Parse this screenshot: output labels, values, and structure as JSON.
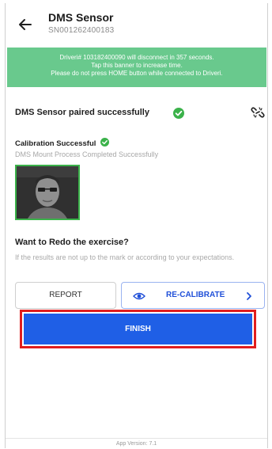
{
  "header": {
    "title": "DMS Sensor",
    "serial": "SN001262400183"
  },
  "banner": {
    "line1": "Driveri# 103182400090 will disconnect in 357 seconds.",
    "line2": "Tap this banner to increase time.",
    "line3": "Please do not press HOME button while connected to Driveri."
  },
  "status": {
    "paired_text": "DMS Sensor paired successfully",
    "calibration_title": "Calibration Successful",
    "calibration_subtitle": "DMS Mount Process Completed Successfully"
  },
  "redo": {
    "title": "Want to Redo the exercise?",
    "description": "If the results are not up to the mark or according to your expectations."
  },
  "buttons": {
    "report": "REPORT",
    "recalibrate": "RE-CALIBRATE",
    "finish": "FINISH"
  },
  "footer": {
    "version": "App Version: 7.1"
  },
  "colors": {
    "banner": "#69c98d",
    "success": "#3bb24a",
    "primary": "#1f5fe6",
    "highlight": "#e01d1d"
  },
  "icons": {
    "back": "arrow-left-icon",
    "check": "check-circle-icon",
    "unlink": "unlink-icon",
    "eye": "eye-icon",
    "chevron": "chevron-right-icon"
  }
}
